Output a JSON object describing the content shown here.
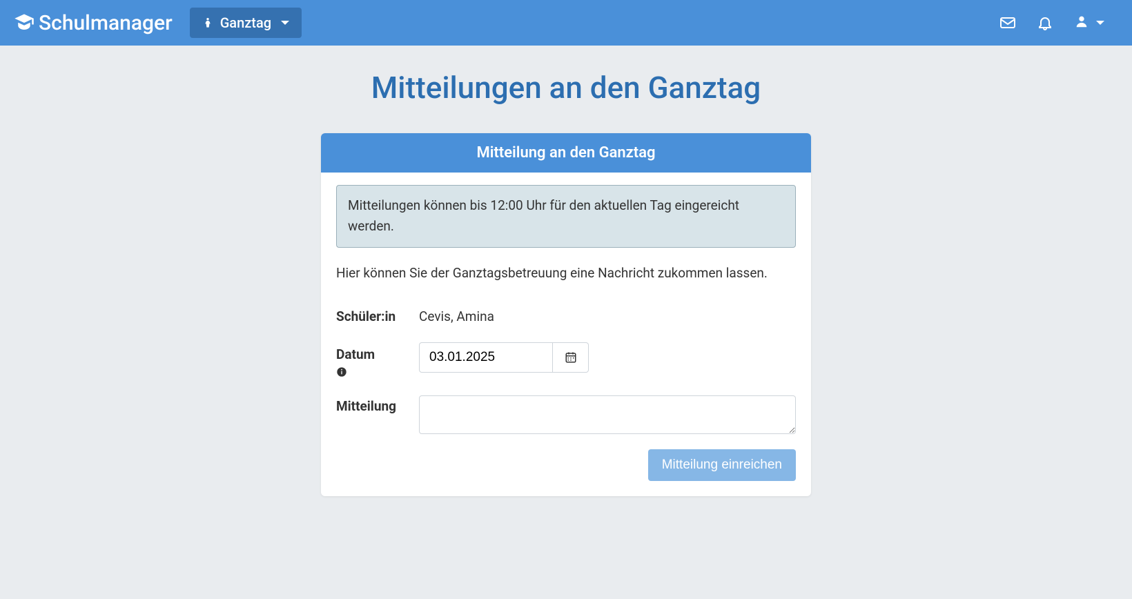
{
  "navbar": {
    "brand_text": "Schulmanager",
    "dropdown_label": "Ganztag"
  },
  "page": {
    "title": "Mitteilungen an den Ganztag"
  },
  "card": {
    "header": "Mitteilung an den Ganztag",
    "info_box": "Mitteilungen können bis 12:00 Uhr für den aktuellen Tag eingereicht werden.",
    "description": "Hier können Sie der Ganztagsbetreuung eine Nachricht zukommen lassen."
  },
  "form": {
    "student_label": "Schüler:in",
    "student_value": "Cevis, Amina",
    "date_label": "Datum",
    "date_value": "03.01.2025",
    "message_label": "Mitteilung",
    "message_value": "",
    "submit_label": "Mitteilung einreichen"
  }
}
